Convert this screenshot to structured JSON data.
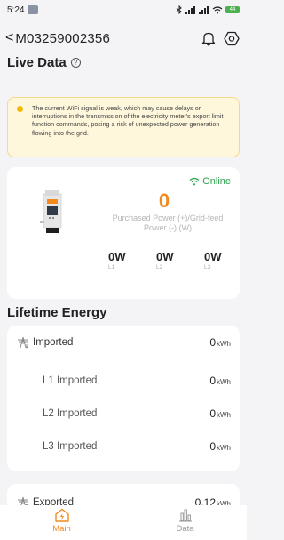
{
  "status_bar": {
    "time": "5:24",
    "signal": "✱ ‡‡ ‡‡",
    "battery": "44"
  },
  "header": {
    "back_symbol": "<",
    "device_id": "M03259002356",
    "bell_icon": "bell-icon",
    "settings_icon": "hexagon-settings-icon"
  },
  "live_data": {
    "title": "Live Data",
    "warning": "The current WiFi signal is weak, which may cause delays or interruptions in the transmission of the electricity meter's export limit function commands, posing a risk of unexpected power generation flowing into the grid.",
    "status": "Online",
    "power_value": "0",
    "power_label": "Purchased Power (+)/Grid-feed Power (-) (W)",
    "phases": [
      {
        "value": "0W",
        "label": "L1"
      },
      {
        "value": "0W",
        "label": "L2"
      },
      {
        "value": "0W",
        "label": "L3"
      }
    ]
  },
  "lifetime": {
    "title": "Lifetime Energy",
    "imported": {
      "label": "Imported",
      "value": "0",
      "unit": "kWh"
    },
    "imported_phases": [
      {
        "label": "L1 Imported",
        "value": "0",
        "unit": "kWh"
      },
      {
        "label": "L2 Imported",
        "value": "0",
        "unit": "kWh"
      },
      {
        "label": "L3 Imported",
        "value": "0",
        "unit": "kWh"
      }
    ],
    "exported": {
      "label": "Exported",
      "value": "0.12",
      "unit": "kWh"
    }
  },
  "nav": {
    "main": "Main",
    "data": "Data"
  },
  "colors": {
    "accent": "#f48a1d",
    "online": "#2ba24c",
    "warning_bg": "#fff7dc"
  }
}
